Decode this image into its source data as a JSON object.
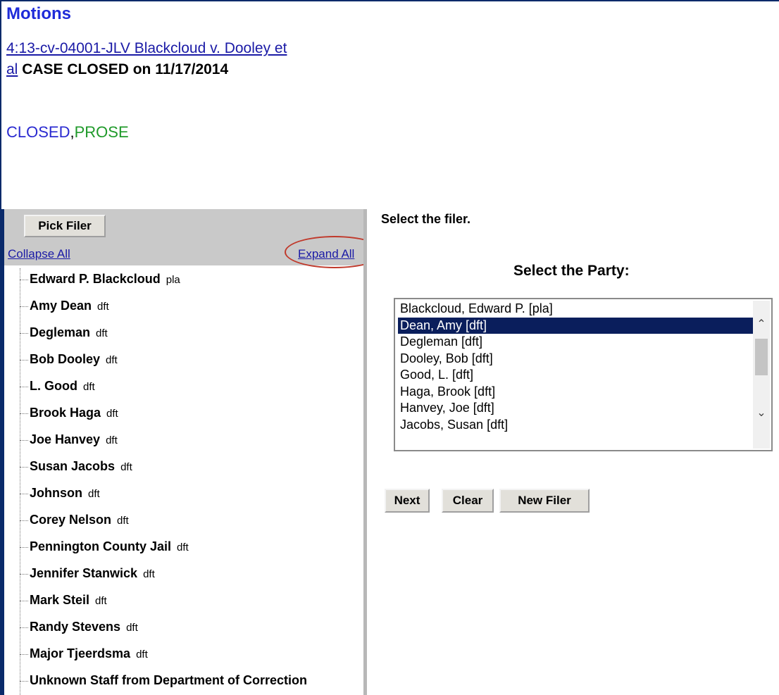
{
  "header": {
    "title": "Motions",
    "case_link": "4:13-cv-04001-JLV Blackcloud v. Dooley et al",
    "case_status": "CASE CLOSED on 11/17/2014",
    "flags": [
      "CLOSED",
      "PROSE"
    ],
    "flag_separator": ",",
    "flag_colors": {
      "CLOSED": "#2a2ad0",
      "PROSE": "#1f9a2a"
    }
  },
  "left_panel": {
    "pick_filer_label": "Pick Filer",
    "collapse_all_label": "Collapse All",
    "expand_all_label": "Expand All",
    "tree_items": [
      {
        "name": "Edward P. Blackcloud",
        "role": "pla"
      },
      {
        "name": "Amy Dean",
        "role": "dft"
      },
      {
        "name": "Degleman",
        "role": "dft"
      },
      {
        "name": "Bob Dooley",
        "role": "dft"
      },
      {
        "name": "L. Good",
        "role": "dft"
      },
      {
        "name": "Brook Haga",
        "role": "dft"
      },
      {
        "name": "Joe Hanvey",
        "role": "dft"
      },
      {
        "name": "Susan Jacobs",
        "role": "dft"
      },
      {
        "name": "Johnson",
        "role": "dft"
      },
      {
        "name": "Corey Nelson",
        "role": "dft"
      },
      {
        "name": "Pennington County Jail",
        "role": "dft"
      },
      {
        "name": "Jennifer Stanwick",
        "role": "dft"
      },
      {
        "name": "Mark Steil",
        "role": "dft"
      },
      {
        "name": "Randy Stevens",
        "role": "dft"
      },
      {
        "name": "Major Tjeerdsma",
        "role": "dft"
      },
      {
        "name": "Unknown Staff from Department of Correction",
        "role": ""
      }
    ]
  },
  "right_panel": {
    "select_filer_label": "Select the filer.",
    "select_party_label": "Select the Party:",
    "party_options": [
      "Blackcloud, Edward P.  [pla]",
      "Dean, Amy  [dft]",
      "Degleman  [dft]",
      "Dooley, Bob  [dft]",
      "Good, L.  [dft]",
      "Haga, Brook  [dft]",
      "Hanvey, Joe  [dft]",
      "Jacobs, Susan  [dft]"
    ],
    "selected_party": "Dean, Amy  [dft]",
    "buttons": {
      "next": "Next",
      "clear": "Clear",
      "new_filer": "New Filer"
    }
  },
  "icons": {
    "scroll_up": "chevron-up-icon",
    "scroll_down": "chevron-down-icon"
  },
  "colors": {
    "link": "#1a1aa6",
    "title": "#1e2bd9",
    "selection": "#0a1e5c",
    "highlight_ring": "#c0392b"
  }
}
